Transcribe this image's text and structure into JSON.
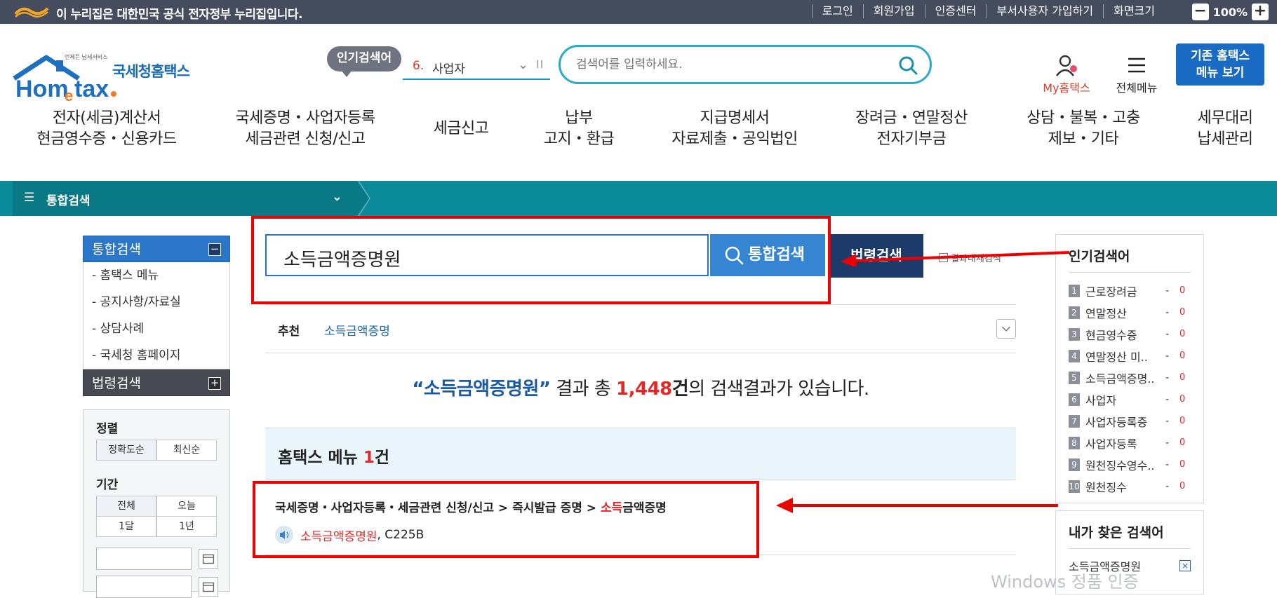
{
  "topbar": {
    "notice": "이 누리집은 대한민국 공식 전자정부 누리집입니다.",
    "links": [
      "로그인",
      "회원가입",
      "인증센터",
      "부서사용자 가입하기",
      "화면크기"
    ],
    "zoom_minus": "−",
    "zoom_value": "100%",
    "zoom_plus": "+"
  },
  "header": {
    "logo_sub": "언제든 납세서비스",
    "logo_brand": "Hometax.",
    "logo_text": "국세청홈택스",
    "popular_badge": "인기검색어",
    "rolling_rank": "6.",
    "rolling_word": "사업자",
    "search_placeholder": "검색어를 입력하세요.",
    "my_hometax": "My홈택스",
    "all_menu": "전체메뉴",
    "legacy_line1": "기존 홈택스",
    "legacy_line2": "메뉴 보기"
  },
  "gnb": [
    {
      "l1": "전자(세금)계산서",
      "l2": "현금영수증・신용카드"
    },
    {
      "l1": "국세증명・사업자등록",
      "l2": "세금관련 신청/신고"
    },
    {
      "l1": "세금신고",
      "l2": ""
    },
    {
      "l1": "납부",
      "l2": "고지・환급"
    },
    {
      "l1": "지급명세서",
      "l2": "자료제출・공익법인"
    },
    {
      "l1": "장려금・연말정산",
      "l2": "전자기부금"
    },
    {
      "l1": "상담・불복・고충",
      "l2": "제보・기타"
    },
    {
      "l1": "세무대리",
      "l2": "납세관리"
    }
  ],
  "navbar": {
    "title": "통합검색"
  },
  "lnb": {
    "head1": "통합검색",
    "head1_toggle": "−",
    "items": [
      "- 홈택스 메뉴",
      "- 공지사항/자료실",
      "- 상담사례",
      "- 국세청 홈페이지"
    ],
    "head2": "법령검색",
    "head2_toggle": "+"
  },
  "filter": {
    "sort_title": "정렬",
    "sort_options": [
      "정확도순",
      "최신순"
    ],
    "period_title": "기간",
    "period_options": [
      "전체",
      "오늘",
      "1달",
      "1년"
    ]
  },
  "search": {
    "query": "소득금액증명원",
    "integrated_btn": "통합검색",
    "law_btn": "법령검색",
    "in_result": "결과내재검색"
  },
  "recommend": {
    "label": "추천",
    "value": "소득금액증명"
  },
  "summary": {
    "open_quote": "“",
    "query": "소득금액증명원",
    "close_quote": "”",
    "pre": " 결과 총 ",
    "count": "1,448",
    "unit": "건",
    "post": "의 검색결과가 있습니다."
  },
  "menu_section": {
    "title": "홈택스 메뉴 ",
    "count": "1",
    "unit": "건"
  },
  "result": {
    "path": "국세증명・사업자등록・세금관련 신청/신고 > 즉시발급 증명 > ",
    "path_hl": "소득",
    "path_end": "금액증명",
    "name": "소득금액증명원",
    "code": ", C225B"
  },
  "popular": {
    "title": "인기검색어",
    "items": [
      {
        "no": "1",
        "kw": "근로장려금",
        "dash": "-",
        "val": "0"
      },
      {
        "no": "2",
        "kw": "연말정산",
        "dash": "-",
        "val": "0"
      },
      {
        "no": "3",
        "kw": "현금영수증",
        "dash": "-",
        "val": "0"
      },
      {
        "no": "4",
        "kw": "연말정산 미..",
        "dash": "-",
        "val": "0"
      },
      {
        "no": "5",
        "kw": "소득금액증명..",
        "dash": "-",
        "val": "0"
      },
      {
        "no": "6",
        "kw": "사업자",
        "dash": "-",
        "val": "0"
      },
      {
        "no": "7",
        "kw": "사업자등록증",
        "dash": "-",
        "val": "0"
      },
      {
        "no": "8",
        "kw": "사업자등록",
        "dash": "-",
        "val": "0"
      },
      {
        "no": "9",
        "kw": "원천징수영수..",
        "dash": "-",
        "val": "0"
      },
      {
        "no": "10",
        "kw": "원천징수",
        "dash": "-",
        "val": "0"
      }
    ]
  },
  "my_keywords": {
    "title": "내가 찾은 검색어",
    "item": "소득금액증명원",
    "remove": "×"
  },
  "watermark": "Windows 정품 인증",
  "colors": {
    "topbar": "#454c5e",
    "navbar": "#0b8a9a",
    "primary": "#3685d2",
    "law": "#1d3b6a",
    "highlight": "#e02a2a",
    "annotation": "#ee0000"
  }
}
